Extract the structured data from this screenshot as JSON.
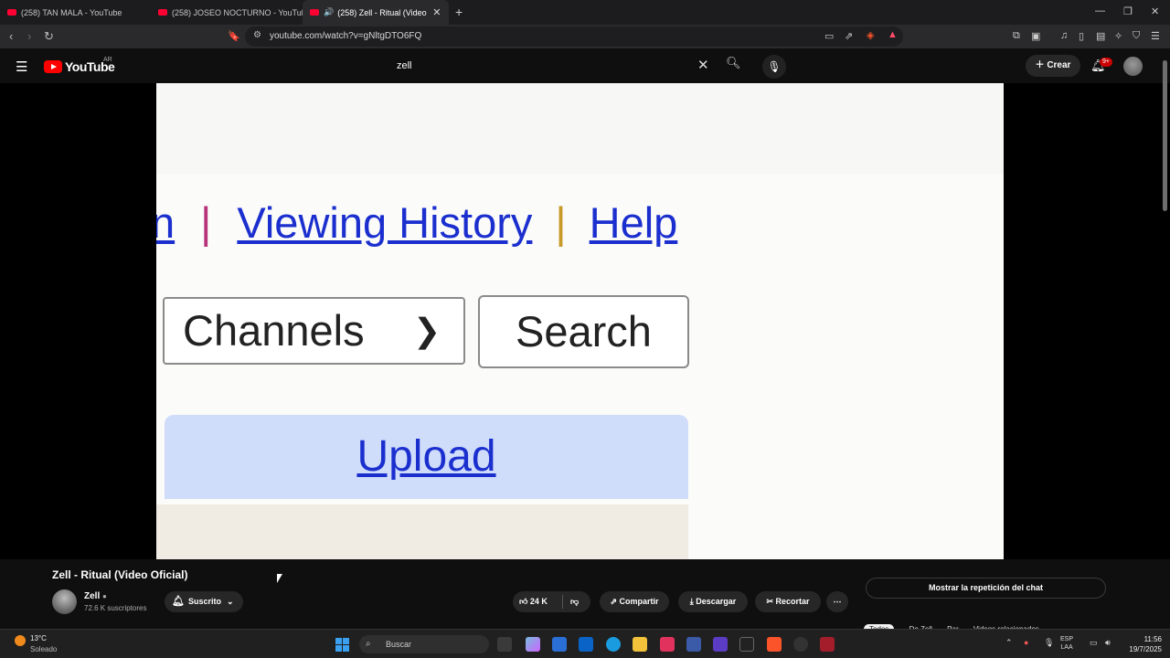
{
  "browser": {
    "tabs": [
      {
        "title": "(258) TAN MALA - YouTube"
      },
      {
        "title": "(258) JOSEO NOCTURNO - YouTube"
      },
      {
        "title": "(258) Zell - Ritual (Video Ofic"
      }
    ],
    "url": "youtube.com/watch?v=gNltgDTO6FQ"
  },
  "youtube": {
    "logo_text": "YouTube",
    "country_code": "AR",
    "search_value": "zell",
    "create_label": "Crear",
    "notif_badge": "9+"
  },
  "video_frame": {
    "partial_link": "n",
    "link_viewing_history": "Viewing History",
    "link_help": "Help",
    "separator": "|",
    "channels_label": "Channels",
    "search_label": "Search",
    "upload_label": "Upload"
  },
  "video": {
    "title": "Zell - Ritual (Video Oficial)",
    "channel": "Zell",
    "subscribers": "72.6 K suscriptores",
    "subscribe_label": "Suscrito",
    "likes": "24 K",
    "share_label": "Compartir",
    "download_label": "Descargar",
    "clip_label": "Recortar",
    "chat_label": "Mostrar la repetición del chat",
    "chips": [
      "Todos",
      "De Zell",
      "Par",
      "Videos relacionados"
    ]
  },
  "taskbar": {
    "temp": "13°C",
    "weather": "Soleado",
    "search_placeholder": "Buscar",
    "lang1": "ESP",
    "lang2": "LAA",
    "time": "11:56",
    "date": "19/7/2025"
  },
  "colors": {
    "yt_red": "#ff0000",
    "link_blue": "#1b2fcf",
    "upload_bg": "#cfdcfa"
  }
}
